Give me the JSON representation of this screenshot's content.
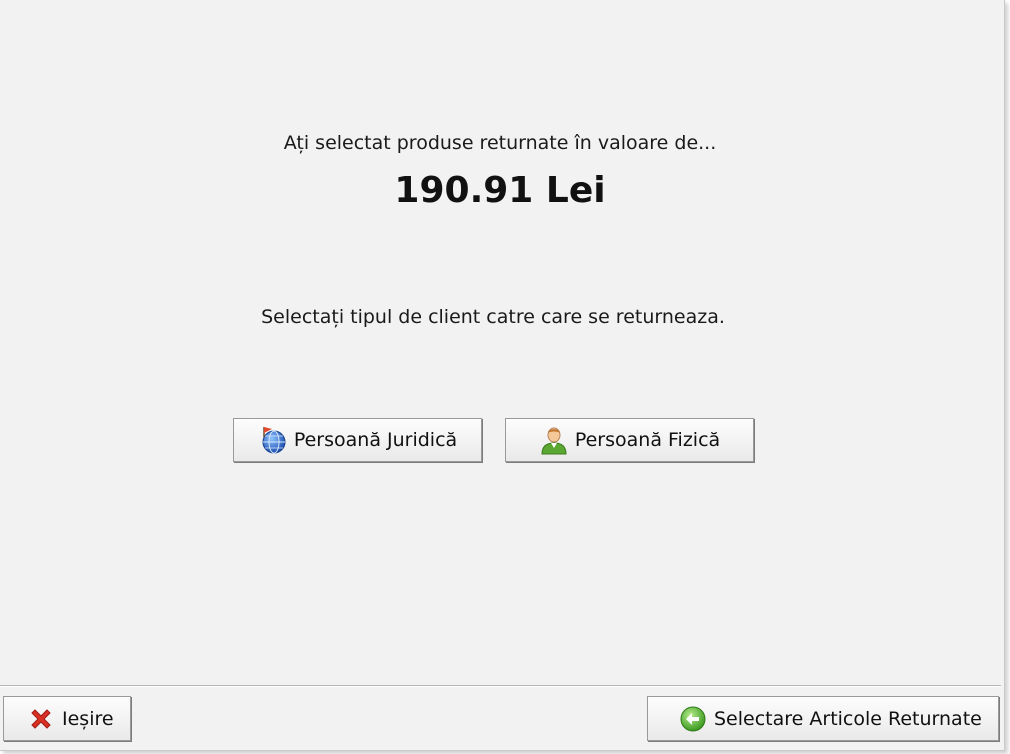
{
  "dialog": {
    "intro_text": "Ați selectat produse returnate în valoare de...",
    "amount": "190.91 Lei",
    "prompt_text": "Selectați tipul de client catre care se returneaza."
  },
  "client_buttons": {
    "juridica": {
      "label": "Persoană Juridică",
      "icon": "globe-flag-icon"
    },
    "fizica": {
      "label": "Persoană Fizică",
      "icon": "person-icon"
    }
  },
  "footer": {
    "exit": {
      "label": "Ieșire",
      "icon": "red-x-icon"
    },
    "select_items": {
      "label": "Selectare Articole Returnate",
      "icon": "green-back-arrow-icon"
    }
  },
  "colors": {
    "background": "#f2f2f3",
    "exit_icon": "#d93025",
    "back_icon": "#4caf50"
  }
}
